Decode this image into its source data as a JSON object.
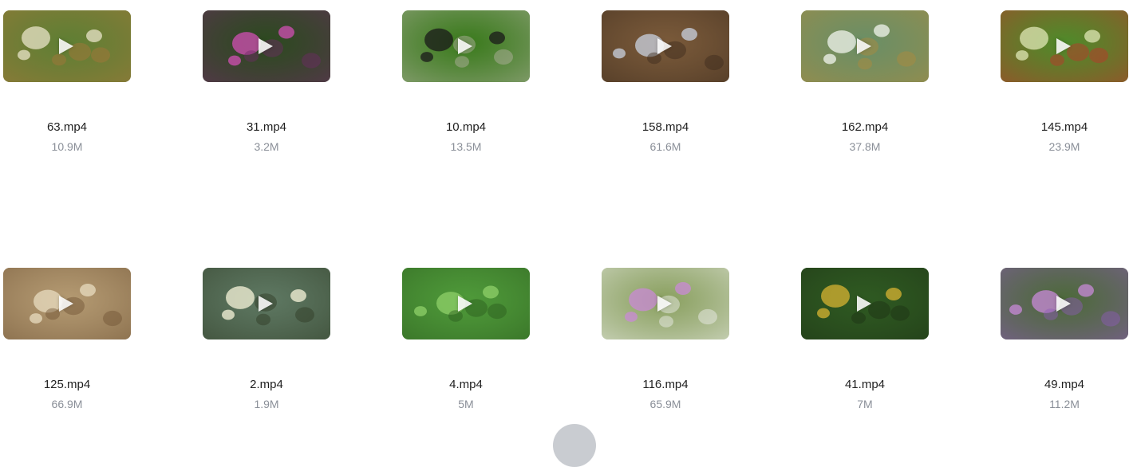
{
  "videos": [
    {
      "name": "63.mp4",
      "size": "10.9M",
      "bg": "#5f7f34",
      "accent": "#e8e4c8",
      "accent2": "#a8763a"
    },
    {
      "name": "31.mp4",
      "size": "3.2M",
      "bg": "#2c4a1f",
      "accent": "#d14fb4",
      "accent2": "#6e2b66"
    },
    {
      "name": "10.mp4",
      "size": "13.5M",
      "bg": "#3a7a1c",
      "accent": "#1a1a1a",
      "accent2": "#b7b4a6"
    },
    {
      "name": "158.mp4",
      "size": "61.6M",
      "bg": "#7a5a3a",
      "accent": "#c9d2e0",
      "accent2": "#3b2a1c"
    },
    {
      "name": "162.mp4",
      "size": "37.8M",
      "bg": "#6a8f66",
      "accent": "#f2f4ee",
      "accent2": "#b08a3c"
    },
    {
      "name": "145.mp4",
      "size": "23.9M",
      "bg": "#4f8a2a",
      "accent": "#dfe7b6",
      "accent2": "#c0322a"
    },
    {
      "name": "125.mp4",
      "size": "66.9M",
      "bg": "#b49a72",
      "accent": "#e8dcc0",
      "accent2": "#6e5234"
    },
    {
      "name": "2.mp4",
      "size": "1.9M",
      "bg": "#5e7862",
      "accent": "#f7f4da",
      "accent2": "#2e3a24"
    },
    {
      "name": "4.mp4",
      "size": "5M",
      "bg": "#4f9a3a",
      "accent": "#8fd06a",
      "accent2": "#2a5a1c"
    },
    {
      "name": "116.mp4",
      "size": "65.9M",
      "bg": "#8aa060",
      "accent": "#c98ad6",
      "accent2": "#f2f2f2"
    },
    {
      "name": "41.mp4",
      "size": "7M",
      "bg": "#2f5a22",
      "accent": "#d8b332",
      "accent2": "#1c3014"
    },
    {
      "name": "49.mp4",
      "size": "11.2M",
      "bg": "#4d6a3a",
      "accent": "#c88ad8",
      "accent2": "#8e5ab8"
    }
  ]
}
